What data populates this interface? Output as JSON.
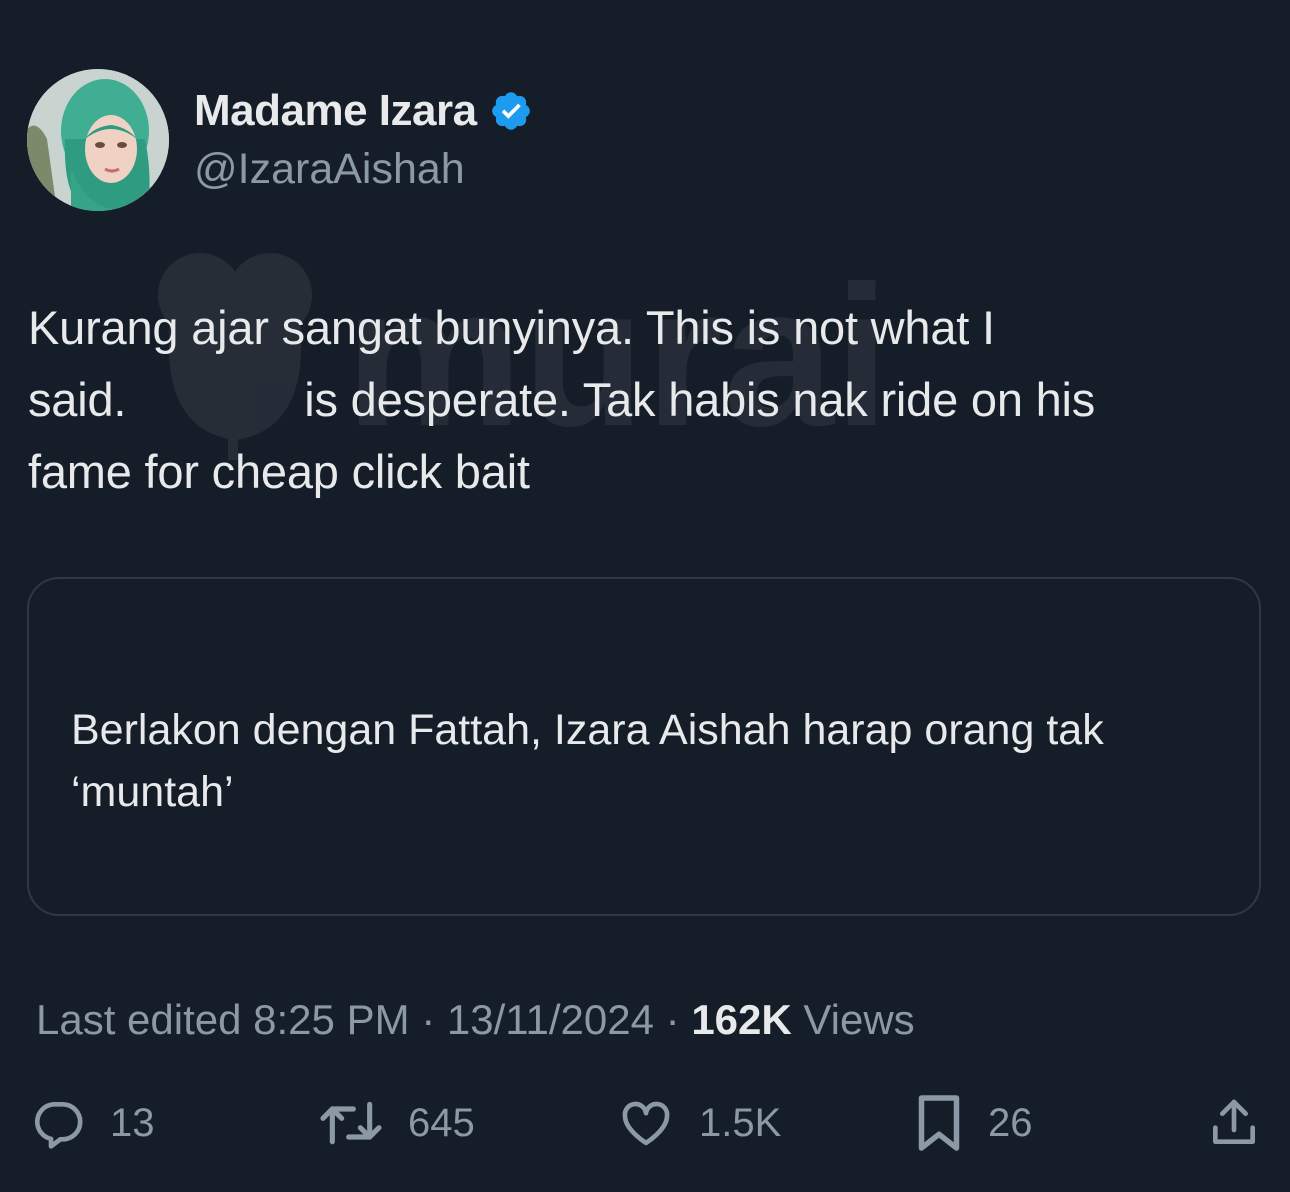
{
  "author": {
    "display_name": "Madame Izara",
    "handle": "@IzaraAishah",
    "verified": true
  },
  "tweet": {
    "lines": [
      "Kurang ajar sangat bunyinya. This is not what I",
      "is desperate. Tak habis nak ride on his",
      "fame for cheap click bait"
    ],
    "line2_lead": "said.",
    "watermark_text": "murai"
  },
  "quote": {
    "headline": "Berlakon dengan Fattah, Izara Aishah harap orang tak ‘muntah’"
  },
  "meta": {
    "edited_label": "Last edited 8:25 PM · 13/11/2024",
    "separator": " · ",
    "views_count": "162K",
    "views_label": " Views"
  },
  "actions": {
    "replies": "13",
    "reposts": "645",
    "likes": "1.5K",
    "bookmarks": "26"
  },
  "colors": {
    "background": "#151d28",
    "text_primary": "#e7e9ea",
    "text_secondary": "#8b98a5",
    "verified_blue": "#1d9bf0",
    "card_border": "#2f3944"
  }
}
